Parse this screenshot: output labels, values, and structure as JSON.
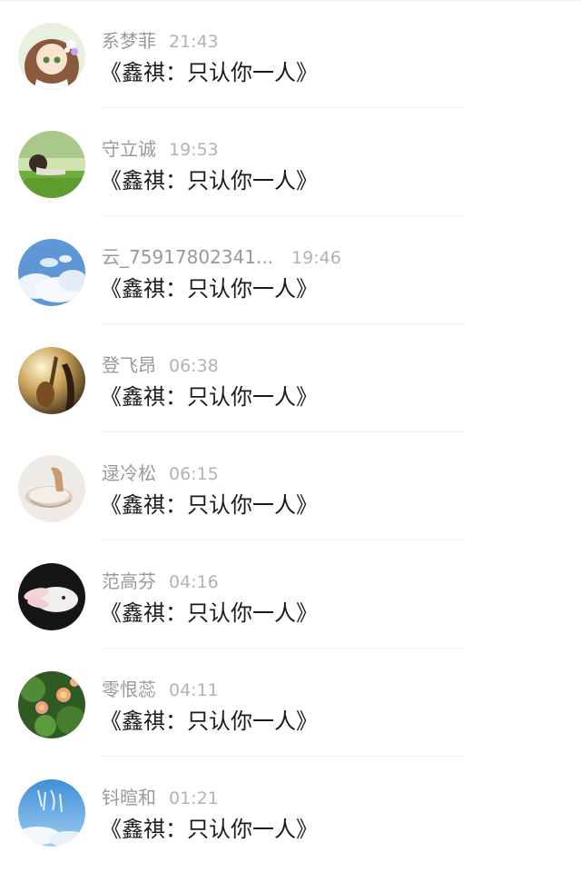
{
  "comments": [
    {
      "name": "系梦菲",
      "time": "21:43",
      "message": "《鑫祺：只认你一人》",
      "avatar_icon": "anime-girl-avatar"
    },
    {
      "name": "守立诚",
      "time": "19:53",
      "message": "《鑫祺：只认你一人》",
      "avatar_icon": "meadow-girl-avatar"
    },
    {
      "name": "云_75917802341...",
      "time": "19:46",
      "message": "《鑫祺：只认你一人》",
      "avatar_icon": "sky-clouds-avatar"
    },
    {
      "name": "登飞昂",
      "time": "06:38",
      "message": "《鑫祺：只认你一人》",
      "avatar_icon": "violin-sunset-avatar"
    },
    {
      "name": "逯冷松",
      "time": "06:15",
      "message": "《鑫祺：只认你一人》",
      "avatar_icon": "hand-shell-avatar"
    },
    {
      "name": "范高芬",
      "time": "04:16",
      "message": "《鑫祺：只认你一人》",
      "avatar_icon": "white-rabbit-avatar"
    },
    {
      "name": "零恨蕊",
      "time": "04:11",
      "message": "《鑫祺：只认你一人》",
      "avatar_icon": "lotus-flowers-avatar"
    },
    {
      "name": "钭暄和",
      "time": "01:21",
      "message": "《鑫祺：只认你一人》",
      "avatar_icon": "blue-sky-calligraphy-avatar"
    }
  ]
}
